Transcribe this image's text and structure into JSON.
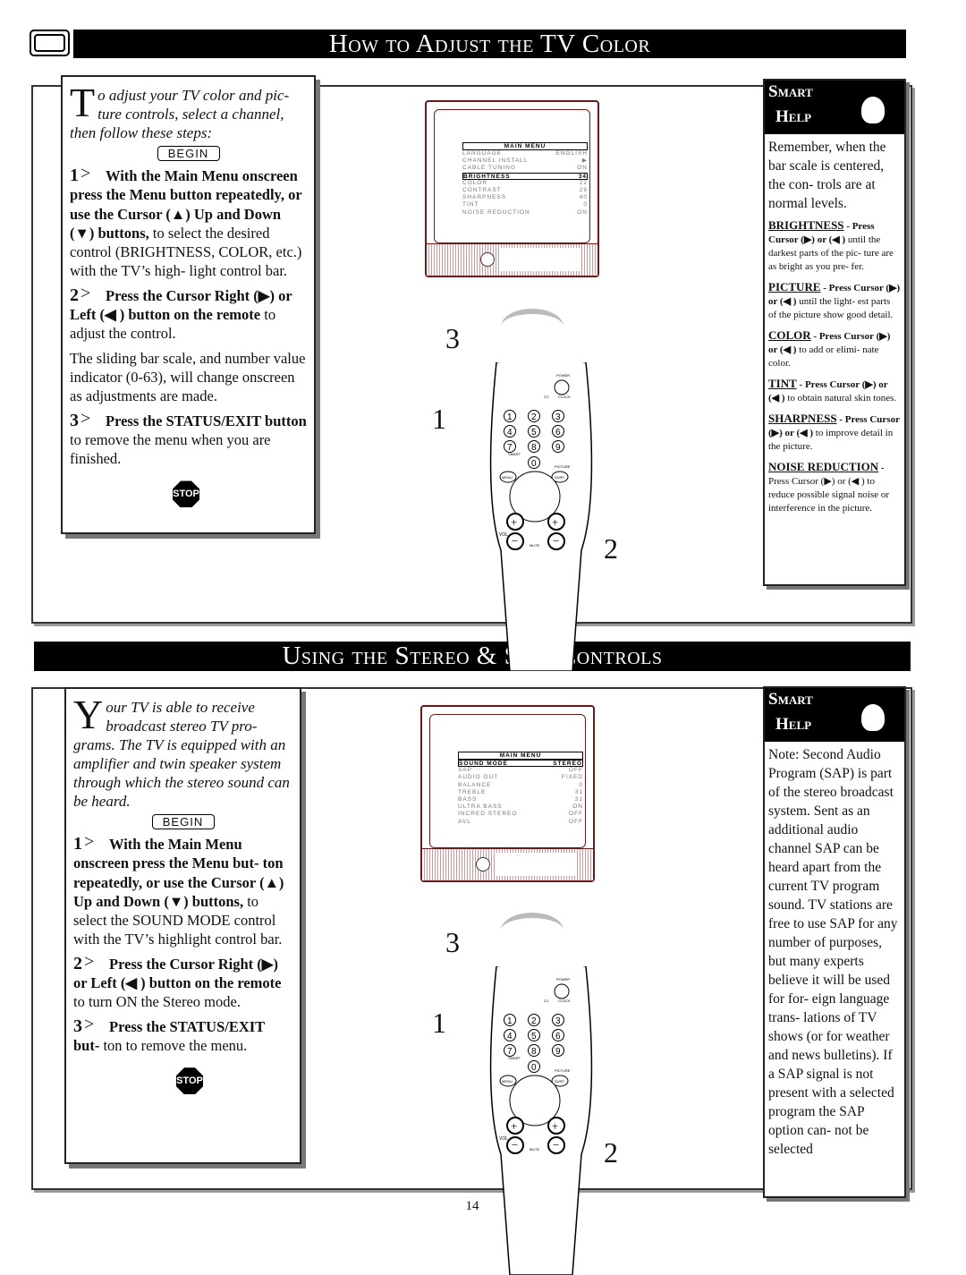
{
  "section1": {
    "title": "How to Adjust the TV Color",
    "intro": "o adjust your TV color and pic- ture controls, select a channel, then follow these steps:",
    "intro_drop": "T",
    "begin": "BEGIN",
    "stop": "STOP",
    "steps": [
      {
        "n": "1",
        "bold": "With the Main Menu onscreen press the Menu button repeatedly, or use the Cursor (▲) Up and Down (▼) buttons,",
        "text": " to select the desired control (BRIGHTNESS, COLOR, etc.) with the TV’s high- light control bar."
      },
      {
        "n": "2",
        "bold": "Press the Cursor Right (▶) or Left (◀ ) button on the remote",
        "text": " to adjust the control."
      },
      {
        "n": "",
        "bold": "",
        "text": "The sliding bar scale, and number value indicator (0-63), will change onscreen as adjustments are made."
      },
      {
        "n": "3",
        "bold": "Press the STATUS/EXIT button",
        "text": " to remove the menu when you are finished."
      }
    ],
    "help": {
      "smart": "Smart",
      "help": "Help",
      "text": "Remember, when the bar scale is centered, the con- trols are at normal levels.",
      "tips": [
        {
          "term": "BRIGHTNESS",
          "bold": " - Press Cursor (▶) or (◀ )",
          "text": " until the darkest parts of the pic- ture are as bright as you pre- fer."
        },
        {
          "term": "PICTURE",
          "bold": " - Press Cursor (▶) or (◀ )",
          "text": " until the light- est parts of the picture show good detail."
        },
        {
          "term": "COLOR",
          "bold": " - Press Cursor (▶) or (◀ )",
          "text": " to add or elimi- nate color."
        },
        {
          "term": "TINT",
          "bold": " - Press Cursor (▶) or (◀ )",
          "text": " to obtain natural skin tones."
        },
        {
          "term": "SHARPNESS",
          "bold": " - Press Cursor (▶) or (◀ )",
          "text": " to improve detail in the picture."
        },
        {
          "term": "NOISE REDUCTION",
          "bold": " -",
          "text": " Press Cursor (▶) or (◀ ) to reduce possible signal noise or interference in the picture."
        }
      ]
    },
    "menu": {
      "title": "MAIN MENU",
      "rows": [
        [
          "LANGUAGE",
          "ENGLISH"
        ],
        [
          "CHANNEL INSTALL",
          "▶"
        ],
        [
          "CABLE TUNING",
          "ON"
        ],
        [
          "BRIGHTNESS",
          "34"
        ],
        [
          "COLOR",
          "22"
        ],
        [
          "CONTRAST",
          "29"
        ],
        [
          "SHARPNESS",
          "40"
        ],
        [
          "TINT",
          "0"
        ],
        [
          "NOISE REDUCTION",
          "ON"
        ]
      ],
      "highlight": 3
    },
    "callouts": [
      "3",
      "1",
      "2"
    ]
  },
  "section2": {
    "title": "Using the Stereo & SAP Controls",
    "intro": "our TV is able to receive broadcast stereo TV pro- grams. The TV is equipped with an amplifier and twin speaker system through which the stereo sound can be heard.",
    "intro_drop": "Y",
    "begin": "BEGIN",
    "stop": "STOP",
    "steps": [
      {
        "n": "1",
        "bold": "With the Main Menu onscreen press the Menu but- ton repeatedly, or use the Cursor (▲) Up and Down (▼) buttons,",
        "text": " to select the SOUND MODE control with the TV’s highlight control bar."
      },
      {
        "n": "2",
        "bold": "Press the Cursor Right (▶) or Left (◀ ) button on the remote",
        "text": " to turn ON the Stereo mode."
      },
      {
        "n": "3",
        "bold": "Press the STATUS/EXIT but-",
        "text": " ton to remove the menu."
      }
    ],
    "help": {
      "smart": "Smart",
      "help": "Help",
      "text": "Note: Second Audio Program (SAP) is part of the stereo broadcast system. Sent as an additional audio channel SAP can be heard apart from the current TV program sound. TV stations are free to use SAP for any number of purposes, but many experts believe it will be used for for- eign language trans- lations of TV shows (or for weather and news bulletins). If a SAP signal is not present with a selected program the SAP option can- not be selected"
    },
    "menu": {
      "title": "MAIN MENU",
      "rows": [
        [
          "SOUND MODE",
          "STEREO"
        ],
        [
          "SAP",
          "OFF"
        ],
        [
          "AUDIO OUT",
          "FIXED"
        ],
        [
          "BALANCE",
          "0"
        ],
        [
          "TREBLE",
          "31"
        ],
        [
          "BASS",
          "31"
        ],
        [
          "ULTRA BASS",
          "ON"
        ],
        [
          "INCRED STEREO",
          "OFF"
        ],
        [
          "AVL",
          "OFF"
        ]
      ],
      "highlight": 0
    },
    "callouts": [
      "3",
      "1",
      "2"
    ]
  },
  "remote": {
    "power": "POWER",
    "cc": "CC",
    "clock": "CLOCK",
    "menu": "MENU",
    "surf": "SURF",
    "vol": "VOL",
    "mute": "MUTE",
    "picture": "PICTURE",
    "smart": "SMART"
  },
  "page_number": "14",
  "colors": {
    "tv_outline": "#6b1a1a",
    "header_bg": "#000000"
  }
}
